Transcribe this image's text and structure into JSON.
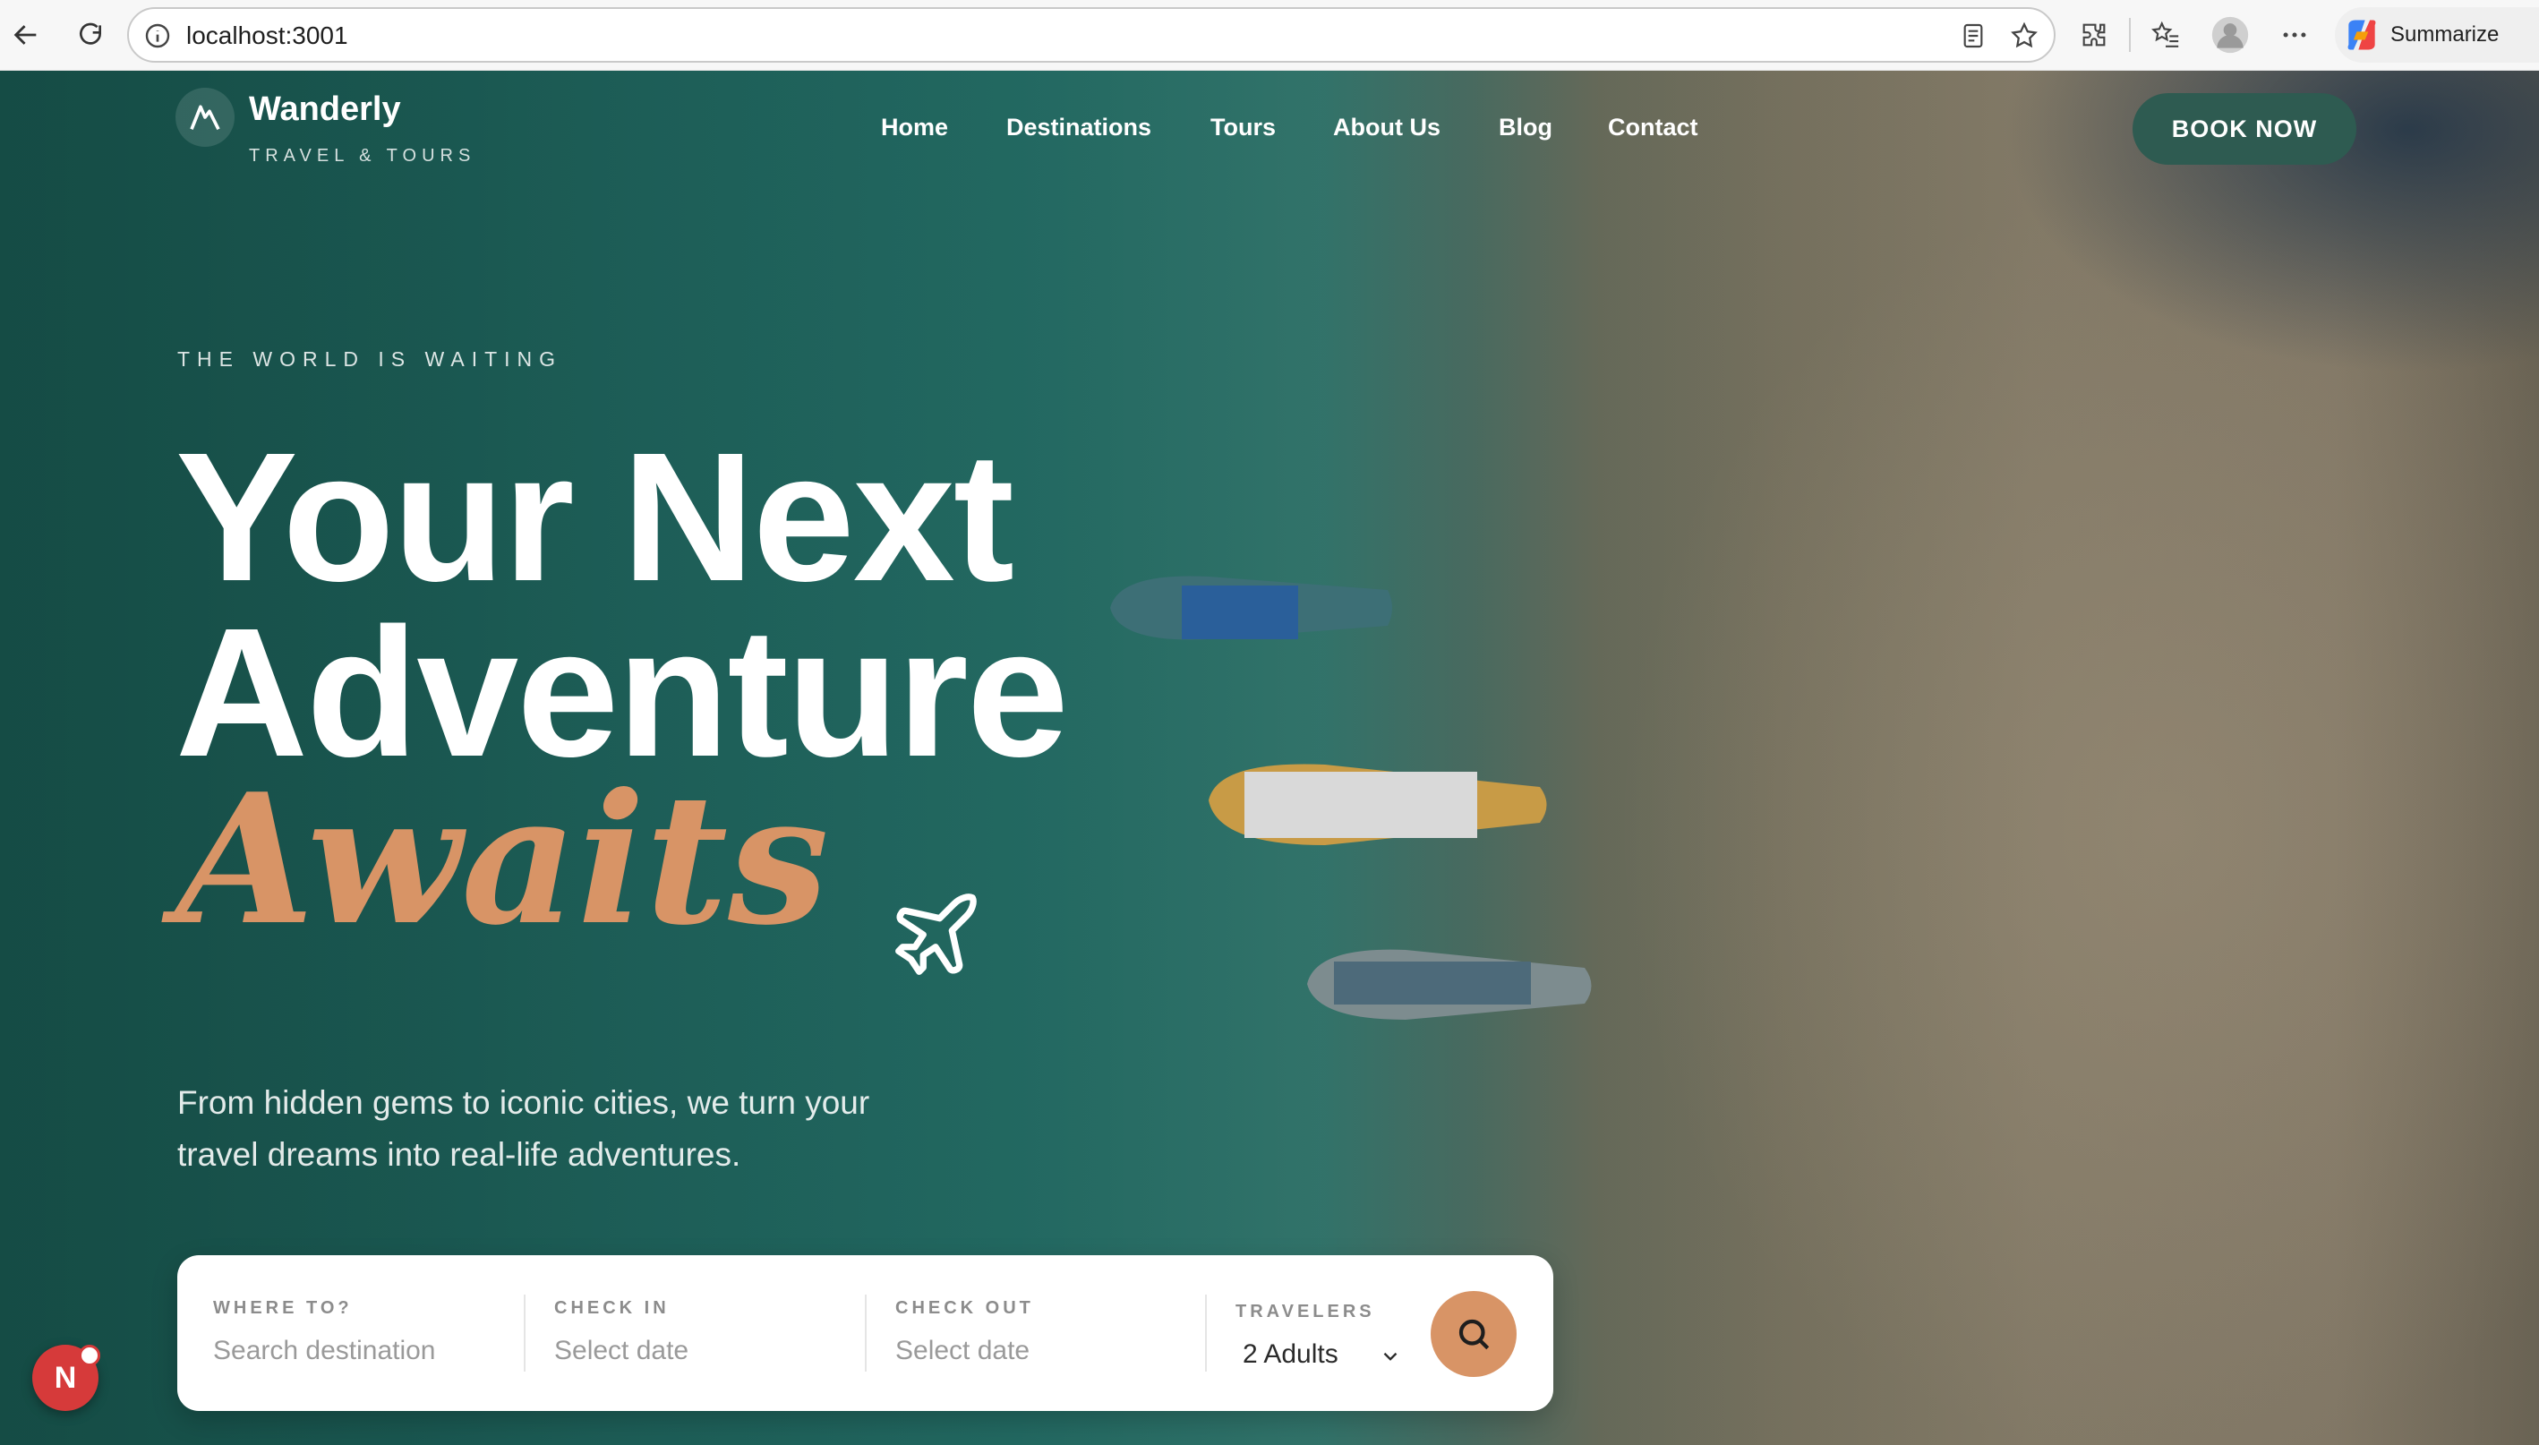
{
  "browser": {
    "url": "localhost:3001",
    "summarize_label": "Summarize"
  },
  "site": {
    "brand_name": "Wanderly",
    "brand_tagline": "TRAVEL & TOURS",
    "nav": [
      "Home",
      "Destinations",
      "Tours",
      "About Us",
      "Blog",
      "Contact"
    ],
    "cta": "BOOK NOW"
  },
  "hero": {
    "eyebrow": "THE WORLD IS WAITING",
    "title_line1": "Your Next",
    "title_line2": "Adventure",
    "title_accent": "Awaits",
    "subtitle": "From hidden gems to iconic cities, we turn your travel dreams into real-life adventures."
  },
  "search": {
    "where_label": "WHERE TO?",
    "where_placeholder": "Search destination",
    "checkin_label": "CHECK IN",
    "checkin_placeholder": "Select date",
    "checkout_label": "CHECK OUT",
    "checkout_placeholder": "Select date",
    "travelers_label": "TRAVELERS",
    "travelers_value": "2 Adults"
  },
  "dev_badge": "N",
  "colors": {
    "accent": "#d89466",
    "brand_green": "#2e5b51"
  }
}
